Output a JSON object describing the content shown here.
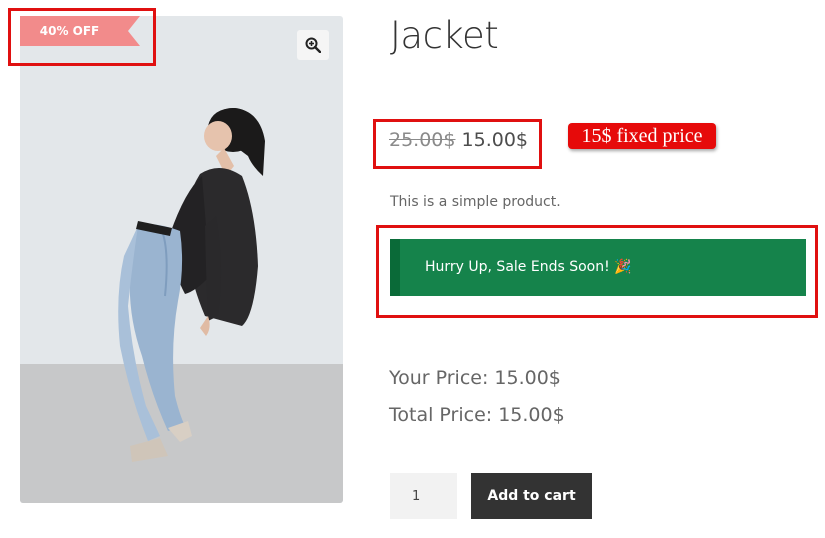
{
  "product": {
    "title": "Jacket",
    "sale_badge": "40% OFF",
    "image_alt": "woman in black jacket and blue jeans leaning back",
    "zoom_icon": "zoom-in-icon",
    "price_old": "25.00$",
    "price_new": "15.00$",
    "description": "This is a simple product.",
    "sale_banner": "Hurry Up, Sale Ends Soon! 🎉",
    "your_price": "Your Price: 15.00$",
    "total_price": "Total Price: 15.00$",
    "quantity": "1",
    "add_to_cart": "Add to cart"
  },
  "annotations": {
    "fixed_price_note": "15$ fixed price"
  },
  "colors": {
    "sale_badge": "#f28b8b",
    "banner_green": "#15834b",
    "annotation_red": "#e01010",
    "button_dark": "#333333"
  }
}
